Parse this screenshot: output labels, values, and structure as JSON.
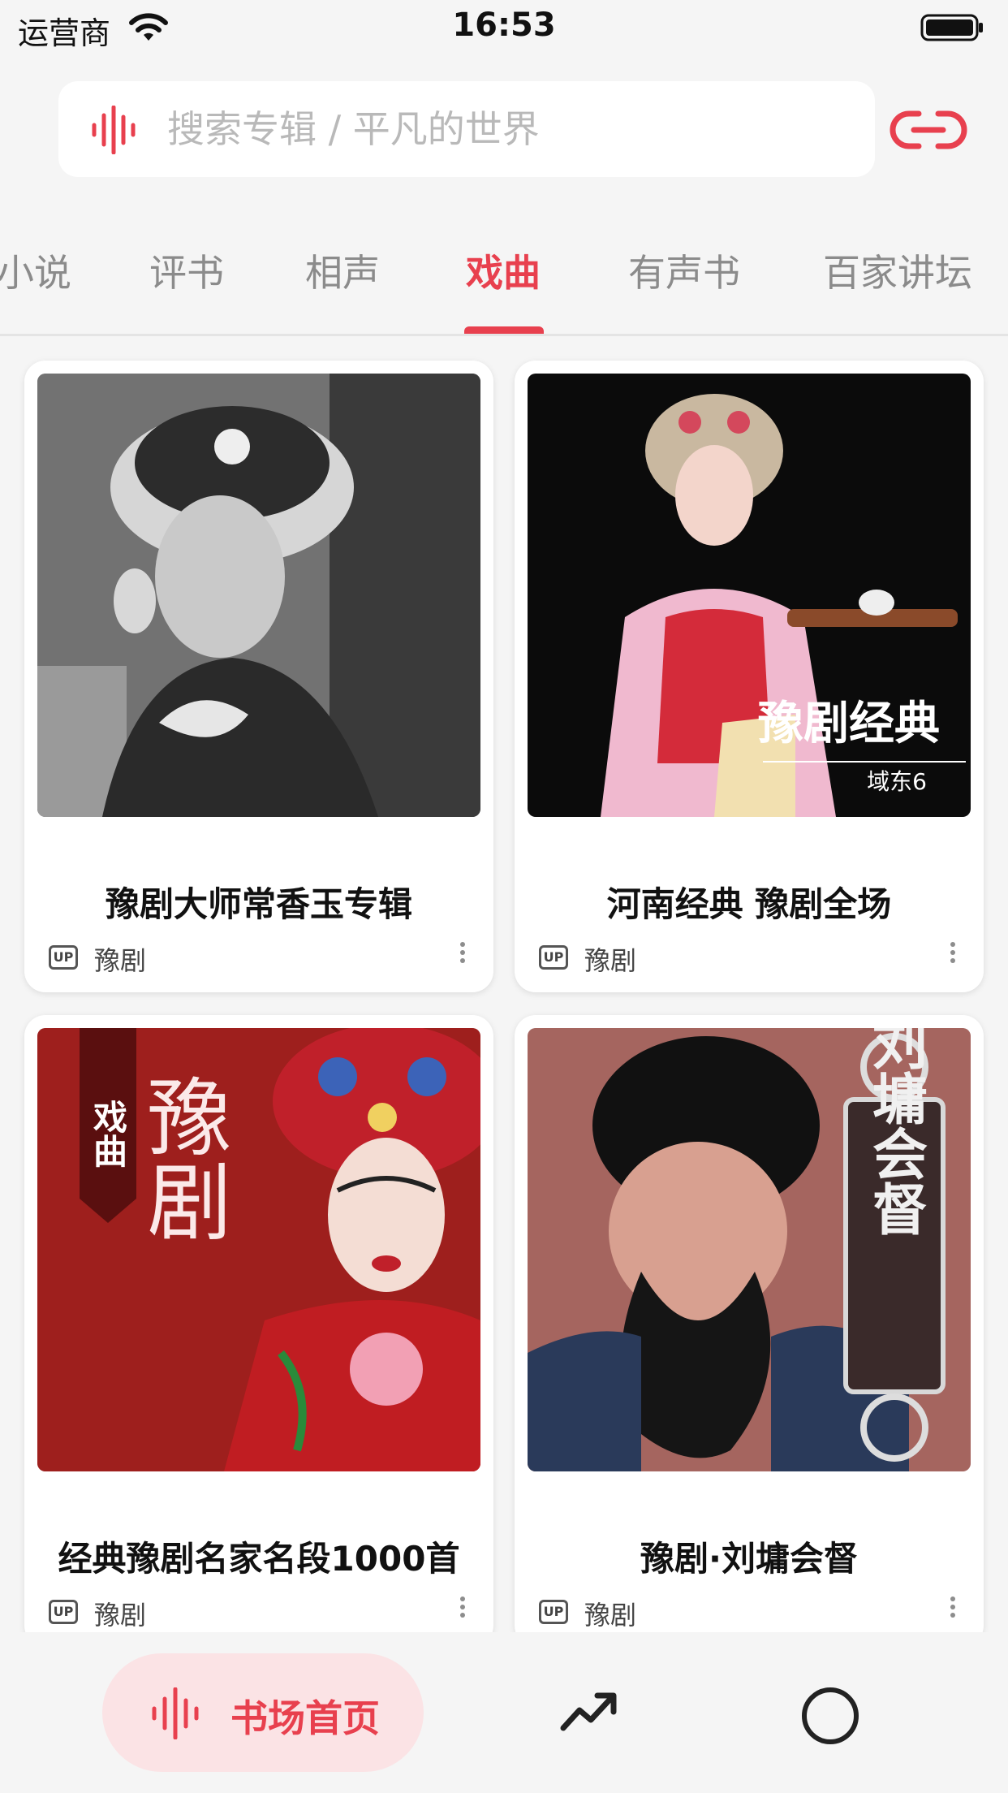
{
  "status_bar": {
    "carrier": "运营商",
    "time": "16:53"
  },
  "search": {
    "placeholder": "搜索专辑 / 平凡的世界",
    "value": ""
  },
  "tabs": [
    {
      "label": "小说",
      "active": false
    },
    {
      "label": "评书",
      "active": false
    },
    {
      "label": "相声",
      "active": false
    },
    {
      "label": "戏曲",
      "active": true
    },
    {
      "label": "有声书",
      "active": false
    },
    {
      "label": "百家讲坛",
      "active": false
    }
  ],
  "albums": [
    {
      "title": "豫剧大师常香玉专辑",
      "badge": "UP",
      "category": "豫剧",
      "cover_text": ""
    },
    {
      "title": "河南经典 豫剧全场",
      "badge": "UP",
      "category": "豫剧",
      "cover_text": "豫剧经典",
      "cover_subtext": "域东6"
    },
    {
      "title": "经典豫剧名家名段1000首",
      "badge": "UP",
      "category": "豫剧",
      "cover_text": "豫剧",
      "cover_tag": "戏曲"
    },
    {
      "title": "豫剧·刘墉会督",
      "badge": "UP",
      "category": "豫剧",
      "cover_text": "刘墉会督"
    }
  ],
  "bottom_nav": {
    "home_label": "书场首页"
  },
  "colors": {
    "accent": "#e8404e",
    "accent_soft": "#fbe3e5",
    "background": "#f5f5f5"
  },
  "icons": {
    "search": "sound-wave-icon",
    "link": "link-icon",
    "trend": "trending-icon",
    "profile": "circle-icon"
  }
}
